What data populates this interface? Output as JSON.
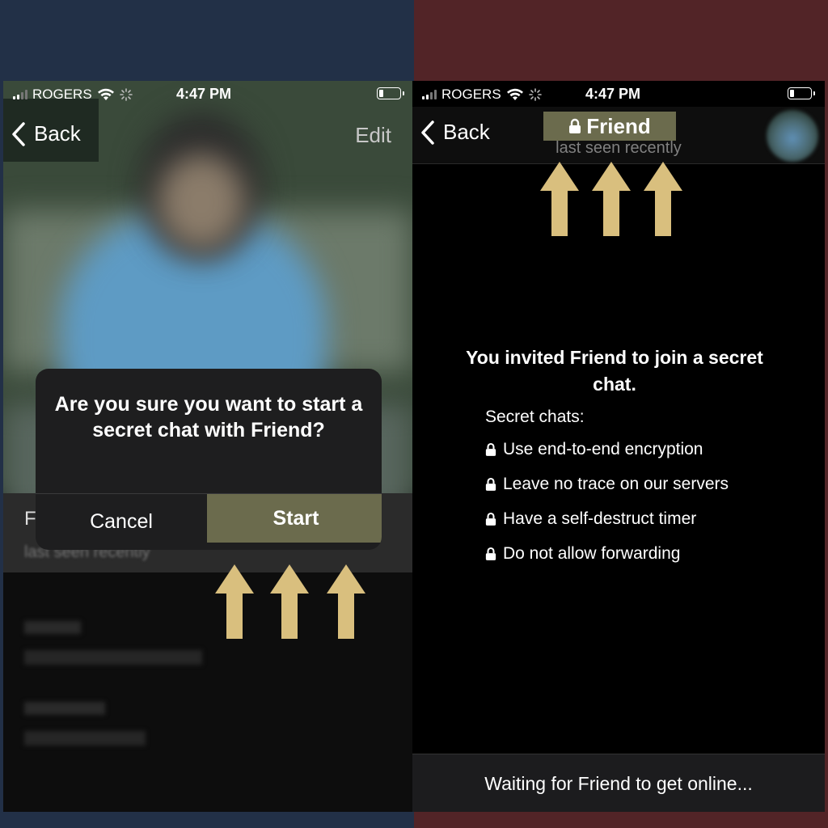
{
  "status_bar": {
    "carrier": "ROGERS",
    "time": "4:47 PM"
  },
  "left_screen": {
    "back_label": "Back",
    "edit_label": "Edit",
    "alert": {
      "message": "Are you sure you want to start a secret chat with Friend?",
      "cancel_label": "Cancel",
      "start_label": "Start"
    },
    "profile_name_initial": "F",
    "profile_status": "last seen recently"
  },
  "right_screen": {
    "back_label": "Back",
    "title": "Friend",
    "subtitle": "last seen recently",
    "invite_text": "You invited Friend to join a secret chat.",
    "secret_chats_heading": "Secret chats:",
    "features": [
      "Use end-to-end encryption",
      "Leave no trace on our servers",
      "Have a self-destruct timer",
      "Do not allow forwarding"
    ],
    "waiting_text": "Waiting for Friend to get online..."
  },
  "colors": {
    "left_background": "#223047",
    "right_background": "#522427",
    "highlight": "#6b6b4d",
    "arrow": "#d9bf7e"
  },
  "icons": [
    "chevron-left-icon",
    "lock-icon",
    "up-arrow-icon",
    "wifi-icon",
    "signal-icon",
    "battery-icon"
  ]
}
